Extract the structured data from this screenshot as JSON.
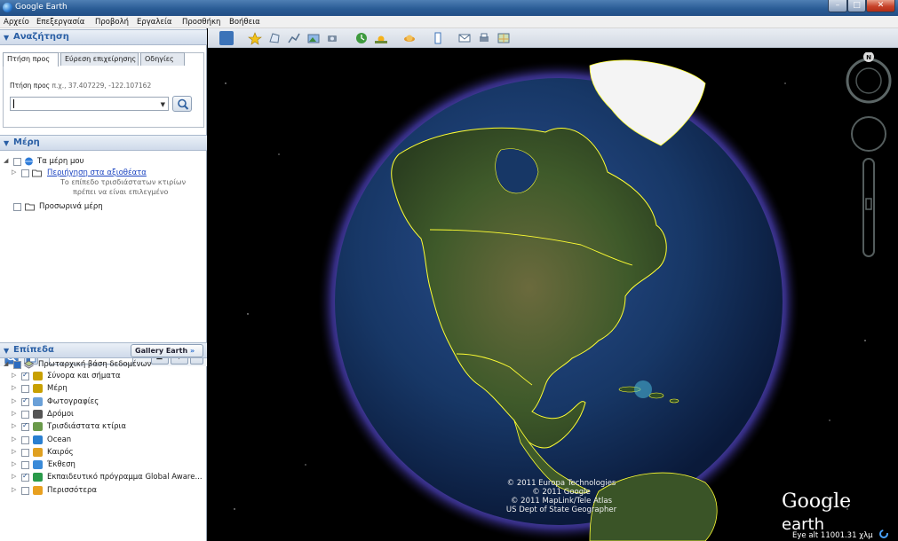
{
  "window": {
    "title": "Google Earth"
  },
  "menu": [
    "Αρχείο",
    "Επεξεργασία",
    "Προβολή",
    "Εργαλεία",
    "Προσθήκη",
    "Βοήθεια"
  ],
  "search": {
    "header": "Αναζήτηση",
    "tabs": [
      "Πτήση προς",
      "Εύρεση επιχείρησης",
      "Οδηγίες"
    ],
    "fly_label": "Πτήση προς",
    "fly_hint": "π.χ., 37.407229, -122.107162",
    "input_value": ""
  },
  "places": {
    "header": "Μέρη",
    "my_places": "Τα μέρη μου",
    "sightseeing": "Περιήγηση στα αξιοθέατα",
    "note_line1": "Το επίπεδο τρισδιάστατων κτιρίων",
    "note_line2": "πρέπει να είναι επιλεγμένο",
    "temporary": "Προσωρινά μέρη"
  },
  "layers": {
    "header": "Επίπεδα",
    "gallery_label": "Gallery Earth",
    "gallery_arrow": "»",
    "primary_db": "Πρωταρχική βάση δεδομένων",
    "items": [
      {
        "label": "Σύνορα και σήματα",
        "checked": true
      },
      {
        "label": "Μέρη",
        "checked": false
      },
      {
        "label": "Φωτογραφίες",
        "checked": true
      },
      {
        "label": "Δρόμοι",
        "checked": false
      },
      {
        "label": "Τρισδιάστατα κτίρια",
        "checked": true
      },
      {
        "label": "Ocean",
        "checked": false
      },
      {
        "label": "Καιρός",
        "checked": false
      },
      {
        "label": "Έκθεση",
        "checked": false
      },
      {
        "label": "Εκπαιδευτικό πρόγραμμα Global Aware...",
        "checked": true
      },
      {
        "label": "Περισσότερα",
        "checked": false
      }
    ]
  },
  "viewport": {
    "copyright": [
      "© 2011 Europa Technologies",
      "© 2011 Google",
      "© 2011 MapLink/Tele Atlas",
      "US Dept of State Geographer"
    ],
    "logo_google": "Google",
    "logo_earth": "earth",
    "eye_alt": "Eye alt 11001.31 χλμ",
    "compass_north": "N"
  },
  "colors": {
    "accent": "#2a5fa5",
    "border_line": "#ffff33",
    "atmosphere": "#7a6cff"
  }
}
